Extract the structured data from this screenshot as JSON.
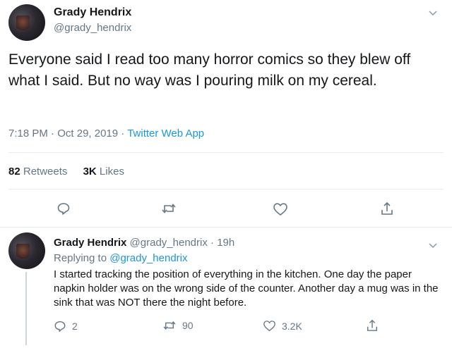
{
  "main_tweet": {
    "author_name": "Grady Hendrix",
    "author_handle": "@grady_hendrix",
    "text": "Everyone said I read too many horror comics so they blew off what I said. But no way was I pouring milk on my cereal.",
    "time": "7:18 PM",
    "separator": "·",
    "date": "Oct 29, 2019",
    "source": "Twitter Web App",
    "retweets_count": "82",
    "retweets_label": "Retweets",
    "likes_count": "3K",
    "likes_label": "Likes"
  },
  "reply_tweet": {
    "author_name": "Grady Hendrix",
    "author_handle": "@grady_hendrix",
    "separator": "·",
    "age": "19h",
    "replying_to_label": "Replying to",
    "replying_to_handle": "@grady_hendrix",
    "text": "I started tracking the position of everything in the kitchen. One day the paper napkin holder was on the wrong side of the counter. Another day a mug was in the sink that was NOT there the night before.",
    "reply_count": "2",
    "retweet_count": "90",
    "like_count": "3.2K"
  },
  "icons": {
    "caret": "chevron-down-icon",
    "reply": "reply-icon",
    "retweet": "retweet-icon",
    "like": "heart-icon",
    "share": "share-icon"
  },
  "colors": {
    "text": "#14171a",
    "secondary": "#657786",
    "link": "#1b95e0",
    "divider": "#e6ecf0"
  }
}
